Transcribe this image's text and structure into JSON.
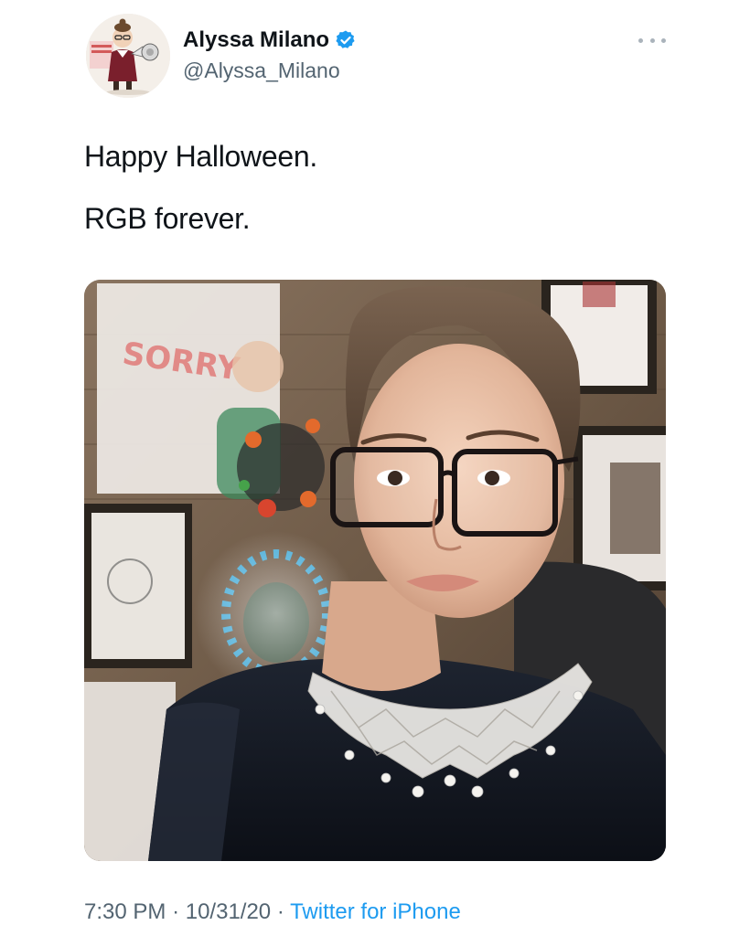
{
  "author": {
    "display_name": "Alyssa Milano",
    "handle": "@Alyssa_Milano",
    "verified": true,
    "avatar_icon": "caricature-avatar-icon"
  },
  "more_icon": "more-horizontal-icon",
  "tweet": {
    "lines": [
      "Happy Halloween.",
      "RGB forever."
    ]
  },
  "meta": {
    "time": "7:30 PM",
    "separator": "·",
    "date": "10/31/20",
    "source": "Twitter for iPhone"
  },
  "colors": {
    "link": "#1d9bf0",
    "verified": "#1d9bf0",
    "secondary_text": "#536471"
  }
}
